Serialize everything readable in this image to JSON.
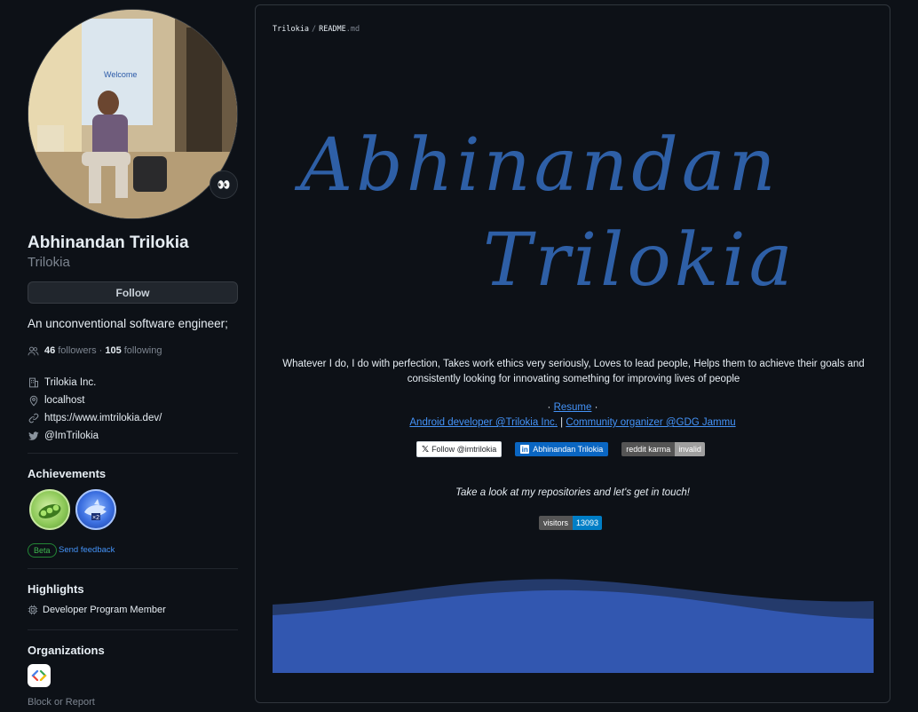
{
  "profile": {
    "name": "Abhinandan Trilokia",
    "login": "Trilokia",
    "status_emoji": "👀",
    "follow_label": "Follow",
    "bio": "An unconventional software engineer;",
    "followers_count": "46",
    "followers_label": "followers",
    "separator": "·",
    "following_count": "105",
    "following_label": "following",
    "company": "Trilokia Inc.",
    "location": "localhost",
    "website": "https://www.imtrilokia.dev/",
    "twitter": "@ImTrilokia"
  },
  "achievements": {
    "title": "Achievements",
    "items": [
      "peas-achievement-icon",
      "shark-achievement-icon"
    ],
    "beta_label": "Beta",
    "feedback_label": "Send feedback"
  },
  "highlights": {
    "title": "Highlights",
    "item": "Developer Program Member"
  },
  "organizations": {
    "title": "Organizations"
  },
  "block_report": "Block or Report",
  "readme": {
    "owner": "Trilokia",
    "crumb_sep": "/",
    "file_name": "README",
    "file_ext": ".md",
    "heading_line1": "Abhinandan",
    "heading_line2": "Trilokia",
    "about": "Whatever I do, I do with perfection, Takes work ethics very seriously, Loves to lead people, Helps them to achieve their goals and consistently looking for innovating something for improving lives of people",
    "dot": "·",
    "resume_label": "Resume",
    "role_link": "Android developer @Trilokia Inc.",
    "pipe": "|",
    "community_link": "Community organizer @GDG Jammu",
    "badge_twitter": "Follow @imtrilokia",
    "badge_linkedin": "Abhinandan Trilokia",
    "badge_reddit_label": "reddit karma",
    "badge_reddit_value": "invalid",
    "tagline": "Take a look at my repositories and let's get in touch!",
    "visitors_label": "visitors",
    "visitors_value": "13093"
  },
  "colors": {
    "background": "#0d1117",
    "accent_link": "#4493f8",
    "handwriting": "#2e5fa6",
    "wave": "#3257b0"
  }
}
